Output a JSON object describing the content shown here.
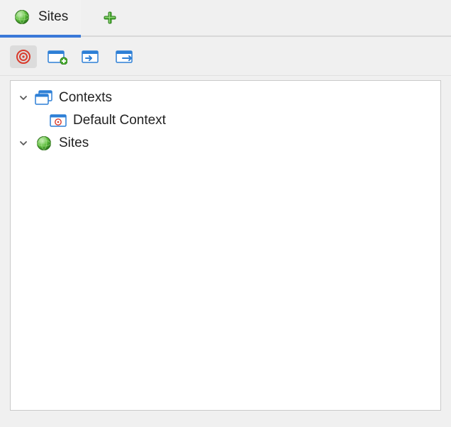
{
  "tabs": {
    "active": {
      "label": "Sites"
    }
  },
  "toolbar": {
    "buttons": [
      "target",
      "new-context",
      "import",
      "export"
    ]
  },
  "tree": {
    "contexts": {
      "label": "Contexts",
      "expanded": true,
      "children": [
        {
          "label": "Default Context"
        }
      ]
    },
    "sites": {
      "label": "Sites",
      "expanded": true,
      "children": []
    }
  }
}
